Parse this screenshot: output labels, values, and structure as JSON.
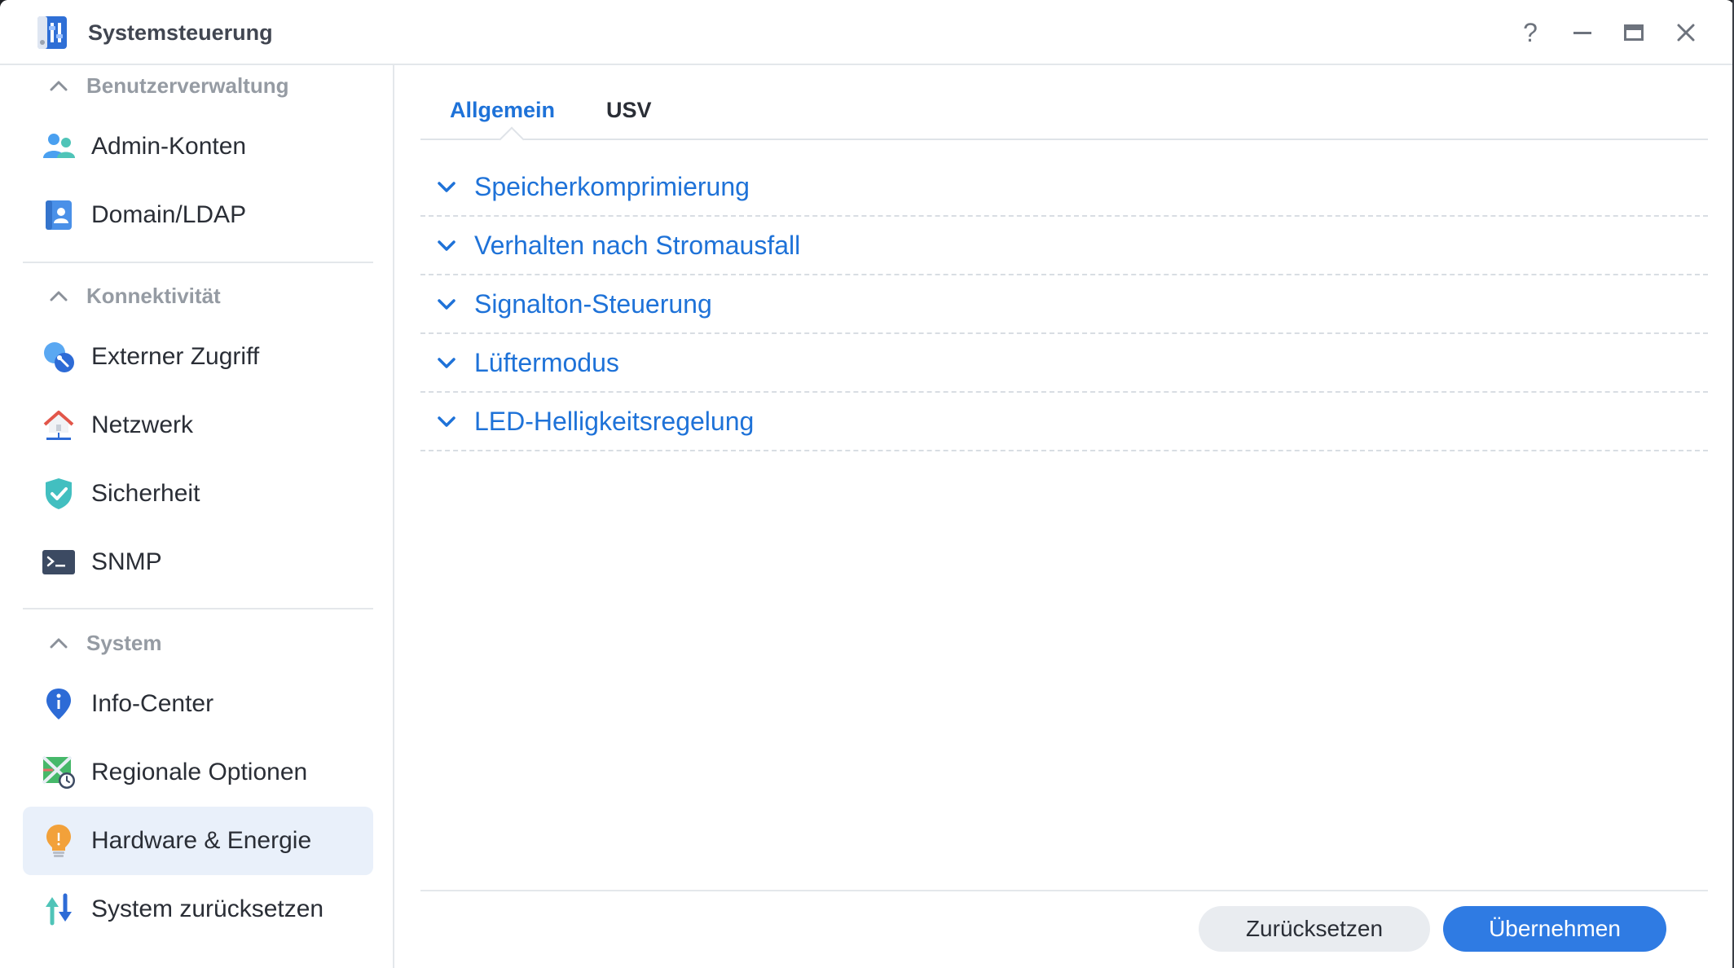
{
  "window": {
    "title": "Systemsteuerung",
    "icon": "control-panel-icon",
    "controls": [
      "help-icon",
      "minimize-icon",
      "maximize-icon",
      "close-icon"
    ],
    "help_label": "?"
  },
  "sidebar": {
    "sections": [
      {
        "label": "Benutzerverwaltung",
        "items": [
          {
            "label": "Admin-Konten",
            "icon": "users-icon"
          },
          {
            "label": "Domain/LDAP",
            "icon": "directory-icon"
          }
        ]
      },
      {
        "label": "Konnektivität",
        "items": [
          {
            "label": "Externer Zugriff",
            "icon": "external-access-icon"
          },
          {
            "label": "Netzwerk",
            "icon": "network-house-icon"
          },
          {
            "label": "Sicherheit",
            "icon": "shield-check-icon"
          },
          {
            "label": "SNMP",
            "icon": "terminal-icon"
          }
        ]
      },
      {
        "label": "System",
        "items": [
          {
            "label": "Info-Center",
            "icon": "info-pin-icon"
          },
          {
            "label": "Regionale Optionen",
            "icon": "map-clock-icon"
          },
          {
            "label": "Hardware & Energie",
            "icon": "lightbulb-icon",
            "active": true
          },
          {
            "label": "System zurücksetzen",
            "icon": "reset-arrows-icon"
          }
        ]
      }
    ]
  },
  "main": {
    "tabs": [
      {
        "label": "Allgemein",
        "active": true
      },
      {
        "label": "USV",
        "active": false
      }
    ],
    "accordion": [
      {
        "label": "Speicherkomprimierung"
      },
      {
        "label": "Verhalten nach Stromausfall"
      },
      {
        "label": "Signalton-Steuerung"
      },
      {
        "label": "Lüftermodus"
      },
      {
        "label": "LED-Helligkeitsregelung"
      }
    ],
    "buttons": {
      "reset_label": "Zurücksetzen",
      "apply_label": "Übernehmen"
    }
  },
  "colors": {
    "accent": "#1e72d8",
    "primary_button": "#2f7be3",
    "active_nav_bg": "#e9f0fa",
    "section_label": "#959ba3"
  }
}
